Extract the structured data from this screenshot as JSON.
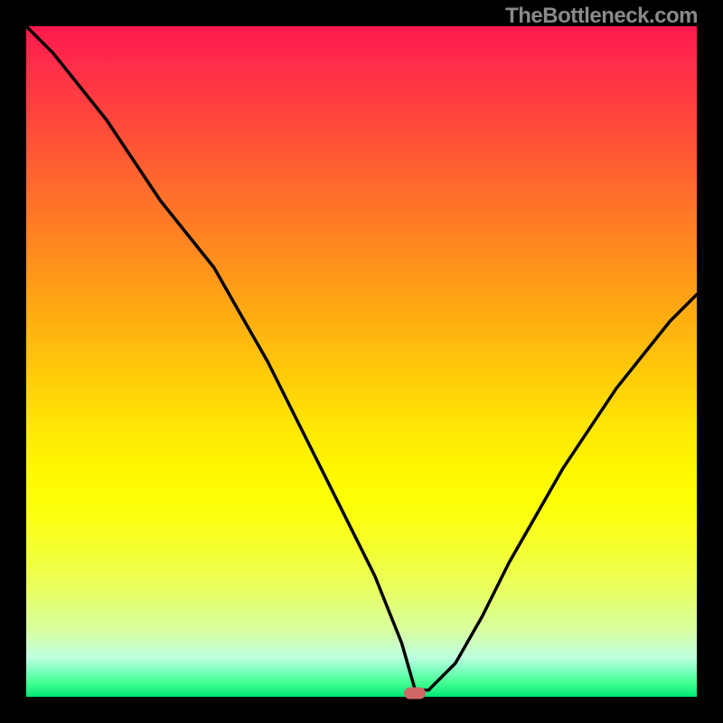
{
  "attribution": "TheBottleneck.com",
  "colors": {
    "bg": "#000000",
    "curve": "#000000",
    "marker": "#d16868",
    "attribution": "#8a8a8a"
  },
  "chart_data": {
    "type": "line",
    "title": "",
    "xlabel": "",
    "ylabel": "",
    "xlim": [
      0,
      100
    ],
    "ylim": [
      0,
      100
    ],
    "grid": false,
    "legend": false,
    "series": [
      {
        "name": "bottleneck-curve",
        "x": [
          0,
          4,
          8,
          12,
          16,
          20,
          24,
          28,
          32,
          36,
          40,
          44,
          48,
          52,
          56,
          58,
          60,
          64,
          68,
          72,
          76,
          80,
          84,
          88,
          92,
          96,
          100
        ],
        "y": [
          100,
          96,
          91,
          86,
          80,
          74,
          69,
          64,
          57,
          50,
          42,
          34,
          26,
          18,
          8,
          1,
          1,
          5,
          12,
          20,
          27,
          34,
          40,
          46,
          51,
          56,
          60
        ]
      }
    ],
    "marker": {
      "x": 58,
      "y": 0.5
    },
    "background_gradient": {
      "type": "vertical",
      "stops": [
        {
          "pos": 0,
          "color": "#ff1a4d"
        },
        {
          "pos": 50,
          "color": "#ffbd0d"
        },
        {
          "pos": 75,
          "color": "#fdff0a"
        },
        {
          "pos": 100,
          "color": "#00e878"
        }
      ]
    }
  }
}
